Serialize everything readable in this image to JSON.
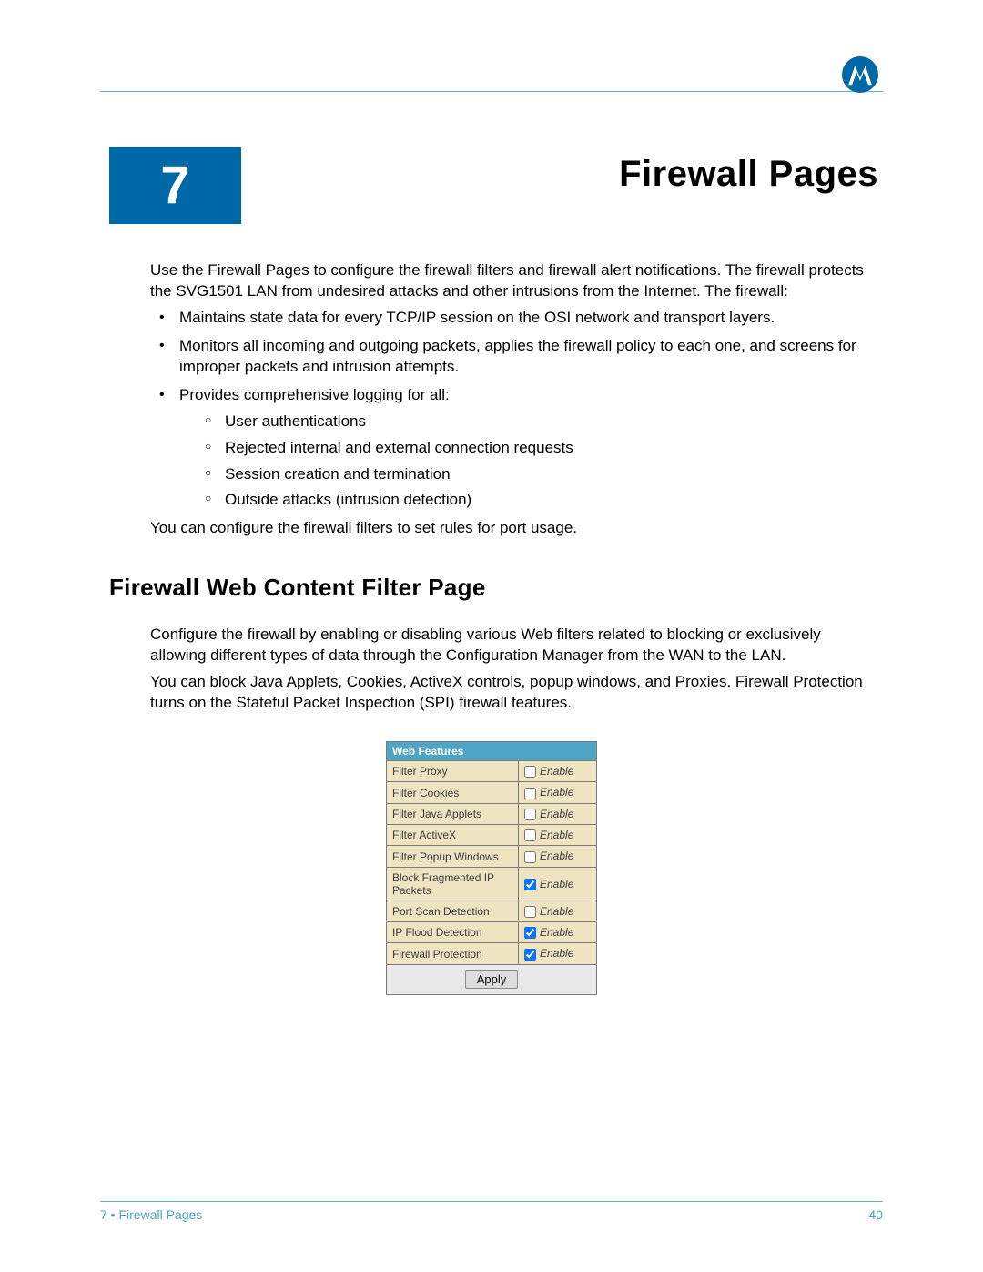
{
  "chapter": {
    "number": "7",
    "title": "Firewall Pages"
  },
  "intro": "Use the Firewall Pages to configure the firewall filters and firewall alert notifications. The firewall protects the SVG1501 LAN from undesired attacks and other intrusions from the Internet. The firewall:",
  "bullets": [
    "Maintains state data for every TCP/IP session on the OSI network and transport layers.",
    "Monitors all incoming and outgoing packets, applies the firewall policy to each one, and screens for improper packets and intrusion attempts.",
    "Provides comprehensive logging for all:"
  ],
  "sub_bullets": [
    "User authentications",
    "Rejected internal and external connection requests",
    "Session creation and termination",
    "Outside attacks (intrusion detection)"
  ],
  "after_bullets": "You can configure the firewall filters to set rules for port usage.",
  "section": {
    "title": "Firewall Web Content Filter Page",
    "p1": "Configure the firewall by enabling or disabling various Web filters related to blocking or exclusively allowing different types of data through the Configuration Manager from the WAN to the LAN.",
    "p2": "You can block Java Applets, Cookies, ActiveX controls, popup windows, and Proxies. Firewall Protection turns on the Stateful Packet Inspection (SPI) firewall features."
  },
  "web_features": {
    "header": "Web Features",
    "enable_label": "Enable",
    "apply_label": "Apply",
    "rows": [
      {
        "label": "Filter Proxy",
        "checked": false
      },
      {
        "label": "Filter Cookies",
        "checked": false
      },
      {
        "label": "Filter Java Applets",
        "checked": false
      },
      {
        "label": "Filter ActiveX",
        "checked": false
      },
      {
        "label": "Filter Popup Windows",
        "checked": false
      },
      {
        "label": "Block Fragmented IP Packets",
        "checked": true
      },
      {
        "label": "Port Scan Detection",
        "checked": false
      },
      {
        "label": "IP Flood Detection",
        "checked": true
      },
      {
        "label": "Firewall Protection",
        "checked": true
      }
    ]
  },
  "footer": {
    "left": "7 • Firewall Pages",
    "right": "40"
  }
}
